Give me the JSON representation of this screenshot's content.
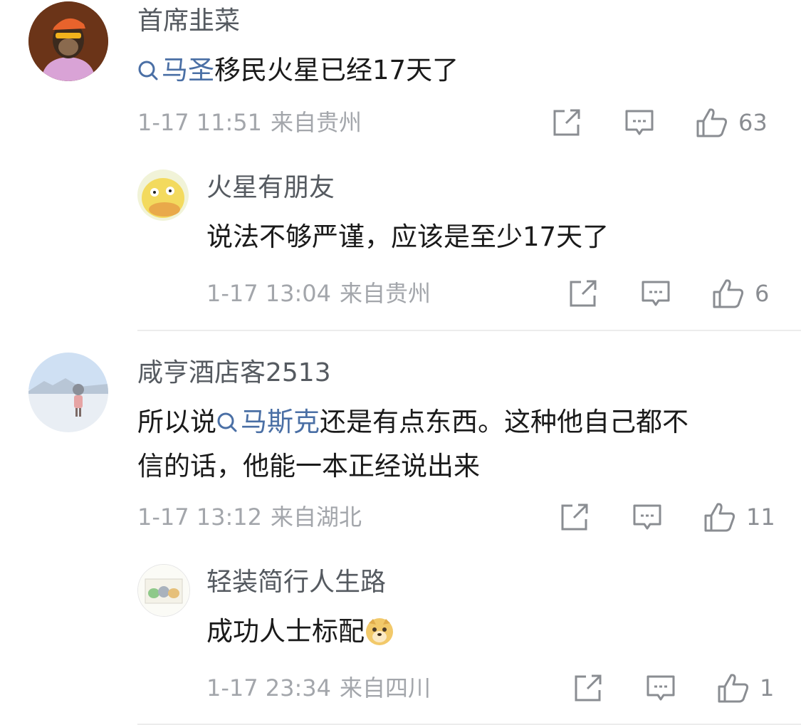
{
  "comments": [
    {
      "username": "首席韭菜",
      "topic": "马圣",
      "text": "移民火星已经17天了",
      "time": "1-17 11:51",
      "location": "来自贵州",
      "likes": "63",
      "avatar_icon": "ape-avatar-icon",
      "reply": {
        "username": "火星有朋友",
        "text": "说法不够严谨，应该是至少17天了",
        "time": "1-17 13:04",
        "location": "来自贵州",
        "likes": "6",
        "avatar_icon": "psyduck-avatar-icon"
      }
    },
    {
      "username": "咸亨酒店客2513",
      "text_prefix": "所以说",
      "topic": "马斯克",
      "text_line1_suffix": "还是有点东西。这种他自己都不",
      "text_line2": "信的话，他能一本正经说出来",
      "time": "1-17 13:12",
      "location": "来自湖北",
      "likes": "11",
      "avatar_icon": "snowfield-girl-avatar-icon",
      "reply": {
        "username": "轻装简行人生路",
        "text": "成功人士标配",
        "emoji": "doge-emoji-icon",
        "time": "1-17 23:34",
        "location": "来自四川",
        "likes": "1",
        "avatar_icon": "cartoon-animals-avatar-icon"
      }
    }
  ]
}
